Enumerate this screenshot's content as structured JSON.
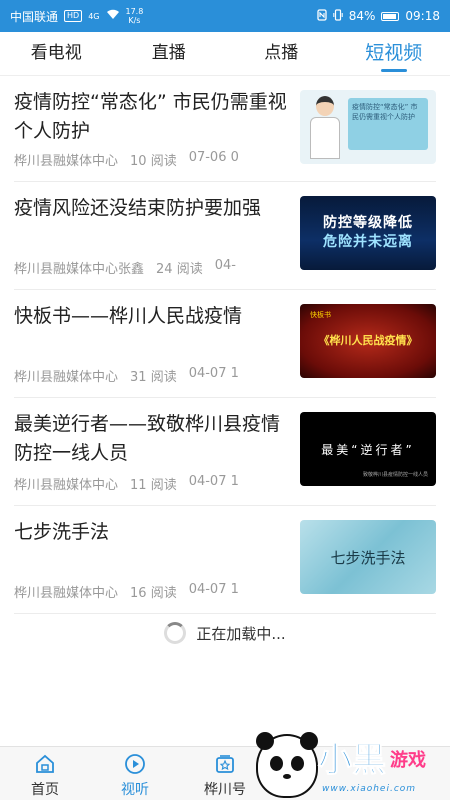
{
  "status_bar": {
    "carrier": "中国联通",
    "hd": "HD",
    "network": "4G",
    "speed_value": "17.8",
    "speed_unit": "K/s",
    "battery": "84%",
    "time": "09:18"
  },
  "tabs": [
    {
      "label": "看电视"
    },
    {
      "label": "直播"
    },
    {
      "label": "点播"
    },
    {
      "label": "短视频"
    }
  ],
  "active_tab": "短视频",
  "items": [
    {
      "title": "疫情防控“常态化” 市民仍需重视个人防护",
      "source": "桦川县融媒体中心",
      "reads": "10 阅读",
      "date": "07-06 0",
      "thumb_text": "疫情防控“常态化” 市民仍需重视个人防护"
    },
    {
      "title": "疫情风险还没结束防护要加强",
      "source": "桦川县融媒体中心张鑫",
      "reads": "24 阅读",
      "date": "04-",
      "thumb_line1": "防控等级降低",
      "thumb_line2": "危险并未远离"
    },
    {
      "title": "快板书——桦川人民战疫情",
      "source": "桦川县融媒体中心",
      "reads": "31 阅读",
      "date": "04-07 1",
      "thumb_small": "快板书",
      "thumb_text": "《桦川人民战疫情》"
    },
    {
      "title": "最美逆行者——致敬桦川县疫情防控一线人员",
      "source": "桦川县融媒体中心",
      "reads": "11 阅读",
      "date": "04-07 1",
      "thumb_text": "最美“逆行者”",
      "thumb_sub": "致敬桦川县疫情防控一线人员"
    },
    {
      "title": "七步洗手法",
      "source": "桦川县融媒体中心",
      "reads": "16 阅读",
      "date": "04-07 1",
      "thumb_text": "七步洗手法"
    }
  ],
  "loading_text": "正在加载中...",
  "bottom_nav": [
    {
      "label": "首页",
      "icon": "home-icon"
    },
    {
      "label": "视听",
      "icon": "play-icon"
    },
    {
      "label": "桦川号",
      "icon": "star-box-icon"
    }
  ],
  "watermark": {
    "brand": "小黑",
    "game": "游戏",
    "url": "www.xiaohei.com"
  },
  "colors": {
    "accent": "#2a8fd9",
    "status_bar": "#2a8fd9",
    "meta_text": "#999999"
  }
}
